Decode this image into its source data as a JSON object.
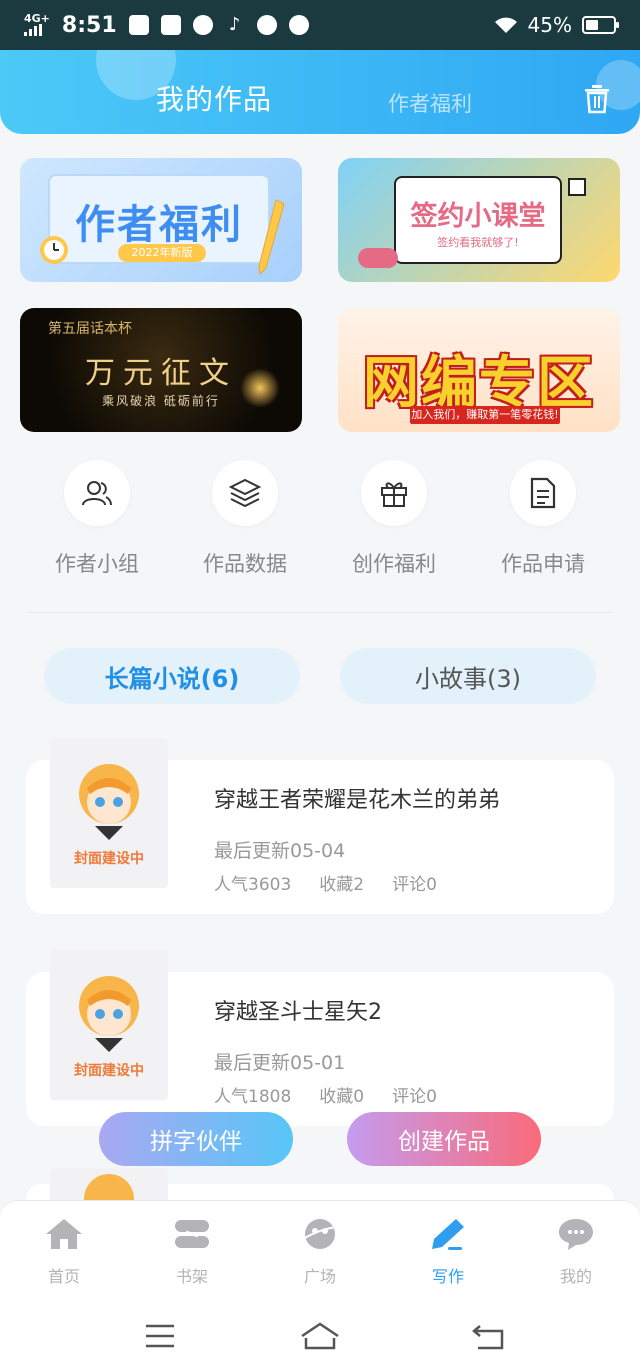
{
  "status_bar": {
    "network": "4G+",
    "time": "8:51",
    "battery_percent": "45%",
    "battery_level": 0.45
  },
  "header": {
    "tabs": [
      {
        "label": "我的作品",
        "active": true
      },
      {
        "label": "作者福利",
        "active": false
      }
    ],
    "accent_color": "#2fa7f3"
  },
  "banners": [
    {
      "title": "作者福利",
      "subtitle": "2022年新版"
    },
    {
      "title": "签约小课堂",
      "subtitle": "签约看我就够了!"
    },
    {
      "top_text": "第五届话本杯",
      "title": "万元征文",
      "subtitle": "乘风破浪 砥砺前行"
    },
    {
      "title": "网编专区",
      "subtitle": "加入我们，赚取第一笔零花钱!"
    }
  ],
  "quick_menu": [
    {
      "label": "作者小组",
      "icon": "user-group-icon"
    },
    {
      "label": "作品数据",
      "icon": "layers-icon"
    },
    {
      "label": "创作福利",
      "icon": "gift-icon"
    },
    {
      "label": "作品申请",
      "icon": "document-icon"
    }
  ],
  "segments": [
    {
      "label": "长篇小说(6)",
      "active": true
    },
    {
      "label": "小故事(3)",
      "active": false
    }
  ],
  "works": [
    {
      "cover_text": "封面建设中",
      "title": "穿越王者荣耀是花木兰的弟弟",
      "updated": "最后更新05-04",
      "popularity": "人气3603",
      "favorites": "收藏2",
      "comments": "评论0"
    },
    {
      "cover_text": "封面建设中",
      "title": "穿越圣斗士星矢2",
      "updated": "最后更新05-01",
      "popularity": "人气1808",
      "favorites": "收藏0",
      "comments": "评论0"
    }
  ],
  "floating_buttons": {
    "partner": "拼字伙伴",
    "create": "创建作品"
  },
  "bottom_nav": [
    {
      "label": "首页",
      "icon": "home-icon",
      "active": false
    },
    {
      "label": "书架",
      "icon": "bookshelf-icon",
      "active": false
    },
    {
      "label": "广场",
      "icon": "planet-icon",
      "active": false
    },
    {
      "label": "写作",
      "icon": "pen-icon",
      "active": true
    },
    {
      "label": "我的",
      "icon": "chat-icon",
      "active": false
    }
  ],
  "colors": {
    "active_nav": "#2f9df0",
    "inactive_nav": "#b4b4b8",
    "segment_active_text": "#1f8fe8"
  }
}
